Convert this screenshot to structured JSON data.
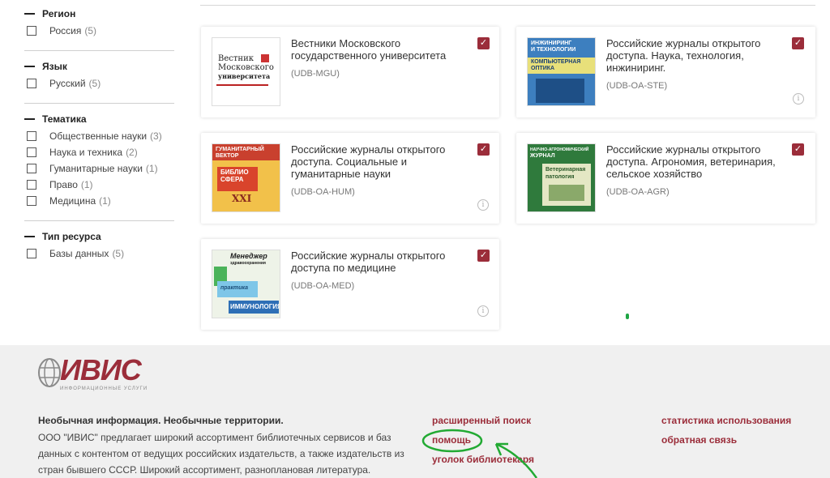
{
  "facets": [
    {
      "title": "Регион",
      "items": [
        {
          "label": "Россия",
          "count": "(5)"
        }
      ]
    },
    {
      "title": "Язык",
      "items": [
        {
          "label": "Русский",
          "count": "(5)"
        }
      ]
    },
    {
      "title": "Тематика",
      "items": [
        {
          "label": "Общественные науки",
          "count": "(3)"
        },
        {
          "label": "Наука и техника",
          "count": "(2)"
        },
        {
          "label": "Гуманитарные науки",
          "count": "(1)"
        },
        {
          "label": "Право",
          "count": "(1)"
        },
        {
          "label": "Медицина",
          "count": "(1)"
        }
      ]
    },
    {
      "title": "Тип ресурса",
      "items": [
        {
          "label": "Базы данных",
          "count": "(5)"
        }
      ]
    }
  ],
  "cards": [
    {
      "title": "Вестники Московского государственного университета",
      "code": "(UDB-MGU)",
      "checked": true,
      "cover": {
        "lines": [
          "Вестник",
          "Московского",
          "университета"
        ]
      }
    },
    {
      "title": "Российские журналы открытого доступа.  Наука, технология, инжиниринг.",
      "code": "(UDB-OA-STE)",
      "checked": true,
      "cover": {
        "lines": [
          "ИНЖИНИРИНГ",
          "И ТЕХНОЛОГИИ",
          "КОМПЬЮТЕРНАЯ",
          "ОПТИКА"
        ]
      }
    },
    {
      "title": "Российские журналы открытого доступа. Социальные и гуманитарные науки",
      "code": "(UDB-OA-HUM)",
      "checked": true,
      "cover": {
        "lines": [
          "ГУМАНИТАРНЫЙ",
          "ВЕКТОР",
          "БИБЛИО",
          "СФЕРА",
          "XXI"
        ]
      }
    },
    {
      "title": "Российские журналы открытого доступа. Агрономия, ветеринария, сельское хозяйство",
      "code": "(UDB-OA-AGR)",
      "checked": true,
      "cover": {
        "lines": [
          "НАУЧНО-АГРОНОМИЧЕСКИЙ",
          "ЖУРНАЛ",
          "Ветеринарная",
          "патология"
        ]
      }
    },
    {
      "title": "Российские журналы открытого доступа по медицине",
      "code": "(UDB-OA-MED)",
      "checked": true,
      "cover": {
        "lines": [
          "Менеджер",
          "здравоохранения",
          "практика",
          "ИММУНОЛОГИЯ"
        ]
      }
    }
  ],
  "icons": {
    "check": "checkmark-icon",
    "info": "info-icon"
  },
  "footer": {
    "logo_text": "ИВИС",
    "logo_sub": "ИНФОРМАЦИОННЫЕ УСЛУГИ",
    "heading": "Необычная информация. Необычные территории.",
    "description": "ООО \"ИВИС\" предлагает широкий ассортимент библиотечных сервисов и баз данных с контентом от ведущих российских издательств, а также издательств из стран бывшего СССР. Широкий ассортимент, разноплановая литература.",
    "links_col1": [
      "расширенный поиск",
      "помощь",
      "уголок библиотекаря"
    ],
    "links_col2": [
      "статистика использования",
      "обратная связь"
    ]
  },
  "colors": {
    "accent": "#9b2d3a",
    "annotation": "#22aa33",
    "footer_bg": "#f0f0f0"
  }
}
